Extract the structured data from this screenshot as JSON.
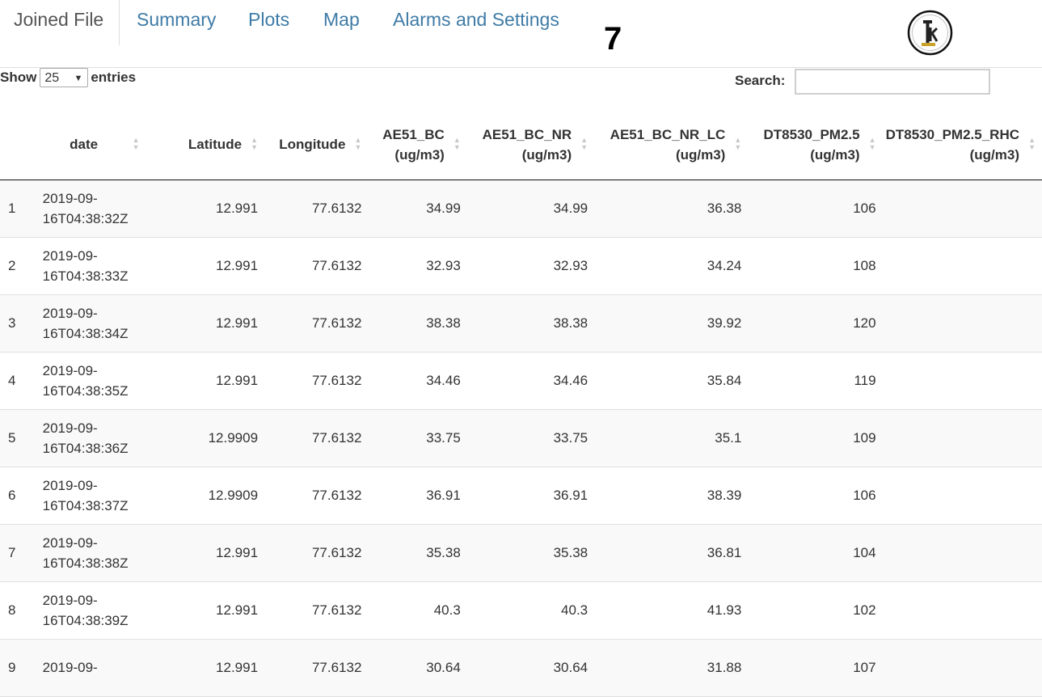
{
  "nav": {
    "tabs": [
      {
        "label": "Joined File",
        "active": true
      },
      {
        "label": "Summary"
      },
      {
        "label": "Plots"
      },
      {
        "label": "Map"
      },
      {
        "label": "Alarms and Settings"
      }
    ],
    "badge": "7",
    "logo_icon": "ik-logo-icon"
  },
  "length": {
    "prefix": "Show",
    "value": "25",
    "suffix": "entries"
  },
  "search": {
    "label": "Search:",
    "value": "",
    "placeholder": ""
  },
  "table": {
    "headers": {
      "date": "date",
      "latitude": "Latitude",
      "longitude": "Longitude",
      "bc_1": "AE51_BC",
      "bc_2": "(ug/m3)",
      "bcnr_1": "AE51_BC_NR",
      "bcnr_2": "(ug/m3)",
      "bcnrlc_1": "AE51_BC_NR_LC",
      "bcnrlc_2": "(ug/m3)",
      "pm_1": "DT8530_PM2.5",
      "pm_2": "(ug/m3)",
      "rhc_1": "DT8530_PM2.5_RHC",
      "rhc_2": "(ug/m3)"
    },
    "rows": [
      {
        "idx": "1",
        "date1": "2019-09-",
        "date2": "16T04:38:32Z",
        "lat": "12.991",
        "lon": "77.6132",
        "bc": "34.99",
        "bcnr": "34.99",
        "bcnrlc": "36.38",
        "pm": "106",
        "rhc": ""
      },
      {
        "idx": "2",
        "date1": "2019-09-",
        "date2": "16T04:38:33Z",
        "lat": "12.991",
        "lon": "77.6132",
        "bc": "32.93",
        "bcnr": "32.93",
        "bcnrlc": "34.24",
        "pm": "108",
        "rhc": ""
      },
      {
        "idx": "3",
        "date1": "2019-09-",
        "date2": "16T04:38:34Z",
        "lat": "12.991",
        "lon": "77.6132",
        "bc": "38.38",
        "bcnr": "38.38",
        "bcnrlc": "39.92",
        "pm": "120",
        "rhc": ""
      },
      {
        "idx": "4",
        "date1": "2019-09-",
        "date2": "16T04:38:35Z",
        "lat": "12.991",
        "lon": "77.6132",
        "bc": "34.46",
        "bcnr": "34.46",
        "bcnrlc": "35.84",
        "pm": "119",
        "rhc": ""
      },
      {
        "idx": "5",
        "date1": "2019-09-",
        "date2": "16T04:38:36Z",
        "lat": "12.9909",
        "lon": "77.6132",
        "bc": "33.75",
        "bcnr": "33.75",
        "bcnrlc": "35.1",
        "pm": "109",
        "rhc": ""
      },
      {
        "idx": "6",
        "date1": "2019-09-",
        "date2": "16T04:38:37Z",
        "lat": "12.9909",
        "lon": "77.6132",
        "bc": "36.91",
        "bcnr": "36.91",
        "bcnrlc": "38.39",
        "pm": "106",
        "rhc": ""
      },
      {
        "idx": "7",
        "date1": "2019-09-",
        "date2": "16T04:38:38Z",
        "lat": "12.991",
        "lon": "77.6132",
        "bc": "35.38",
        "bcnr": "35.38",
        "bcnrlc": "36.81",
        "pm": "104",
        "rhc": ""
      },
      {
        "idx": "8",
        "date1": "2019-09-",
        "date2": "16T04:38:39Z",
        "lat": "12.991",
        "lon": "77.6132",
        "bc": "40.3",
        "bcnr": "40.3",
        "bcnrlc": "41.93",
        "pm": "102",
        "rhc": ""
      },
      {
        "idx": "9",
        "date1": "2019-09-",
        "date2": "",
        "lat": "12.991",
        "lon": "77.6132",
        "bc": "30.64",
        "bcnr": "30.64",
        "bcnrlc": "31.88",
        "pm": "107",
        "rhc": ""
      }
    ]
  }
}
